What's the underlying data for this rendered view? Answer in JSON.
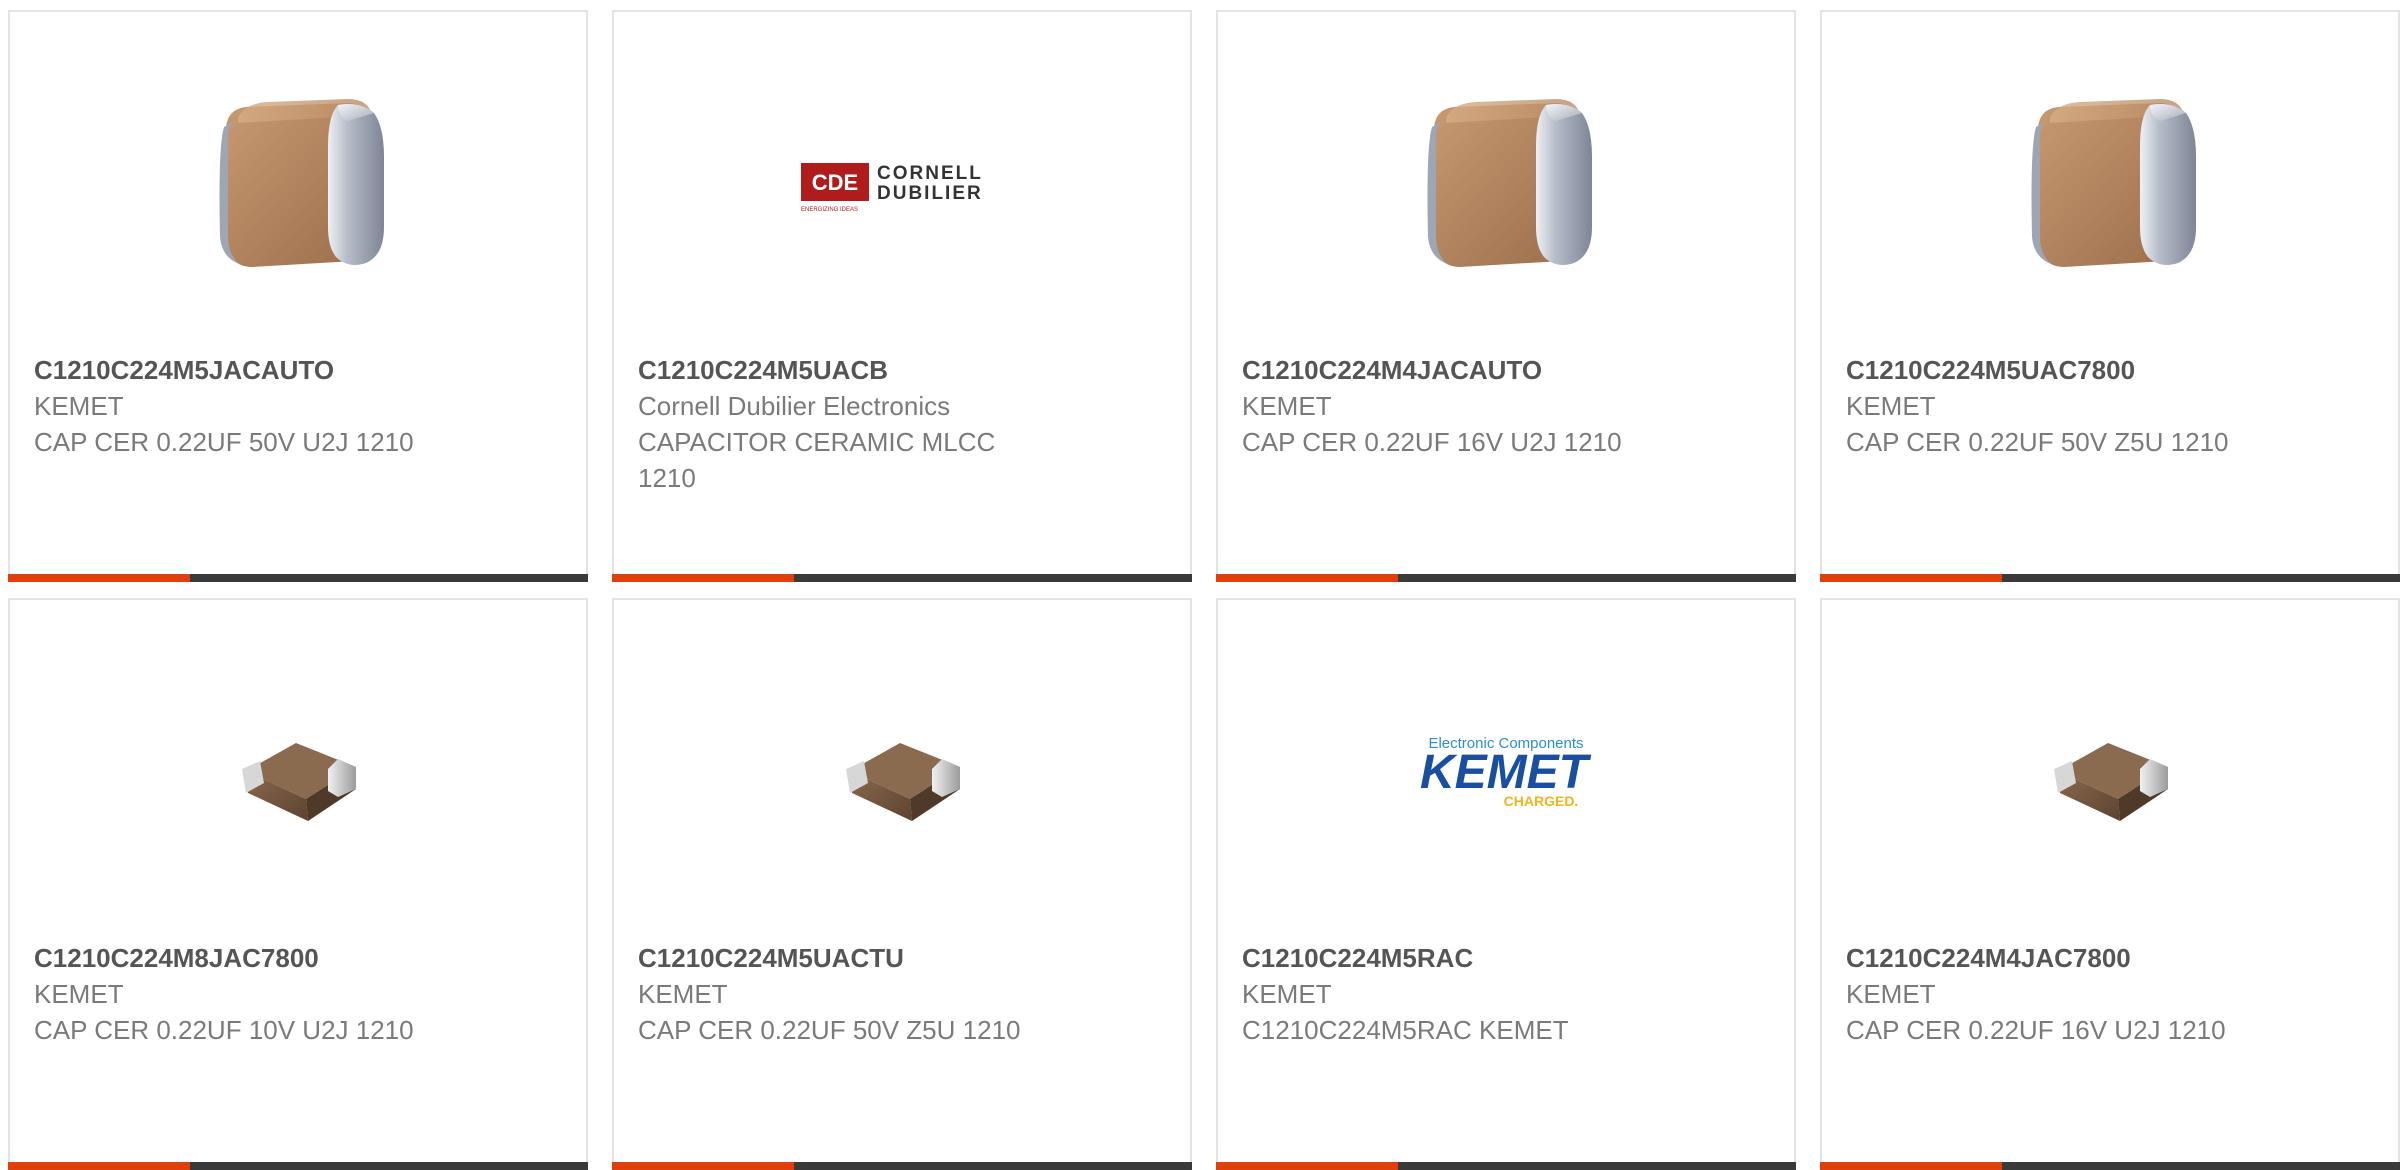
{
  "colors": {
    "accent": "#e0400c",
    "bar": "#3a3a3a",
    "part_number": "#555555",
    "body_text": "#7a7a7a",
    "border": "#e3e3e3"
  },
  "logos": {
    "cornell": {
      "mark": "CDE",
      "name_line1": "CORNELL",
      "name_line2": "DUBILIER",
      "tagline": "ENERGIZING IDEAS"
    },
    "kemet": {
      "top": "Electronic Components",
      "name": "KEMET",
      "tag": "CHARGED."
    }
  },
  "products": [
    {
      "part_number": "C1210C224M5JACAUTO",
      "manufacturer": "KEMET",
      "description": "CAP CER 0.22UF 50V U2J 1210",
      "image": "mlcc-large-icon"
    },
    {
      "part_number": "C1210C224M5UACB",
      "manufacturer": "Cornell Dubilier Electronics",
      "description": "CAPACITOR CERAMIC MLCC 1210",
      "image": "cornell-dubilier-logo"
    },
    {
      "part_number": "C1210C224M4JACAUTO",
      "manufacturer": "KEMET",
      "description": "CAP CER 0.22UF 16V U2J 1210",
      "image": "mlcc-large-icon"
    },
    {
      "part_number": "C1210C224M5UAC7800",
      "manufacturer": "KEMET",
      "description": "CAP CER 0.22UF 50V Z5U 1210",
      "image": "mlcc-large-icon"
    },
    {
      "part_number": "C1210C224M8JAC7800",
      "manufacturer": "KEMET",
      "description": "CAP CER 0.22UF 10V U2J 1210",
      "image": "mlcc-small-icon"
    },
    {
      "part_number": "C1210C224M5UACTU",
      "manufacturer": "KEMET",
      "description": "CAP CER 0.22UF 50V Z5U 1210",
      "image": "mlcc-small-icon"
    },
    {
      "part_number": "C1210C224M5RAC",
      "manufacturer": "KEMET",
      "description": "C1210C224M5RAC KEMET",
      "image": "kemet-logo"
    },
    {
      "part_number": "C1210C224M4JAC7800",
      "manufacturer": "KEMET",
      "description": "CAP CER 0.22UF 16V U2J 1210",
      "image": "mlcc-small-icon"
    }
  ]
}
